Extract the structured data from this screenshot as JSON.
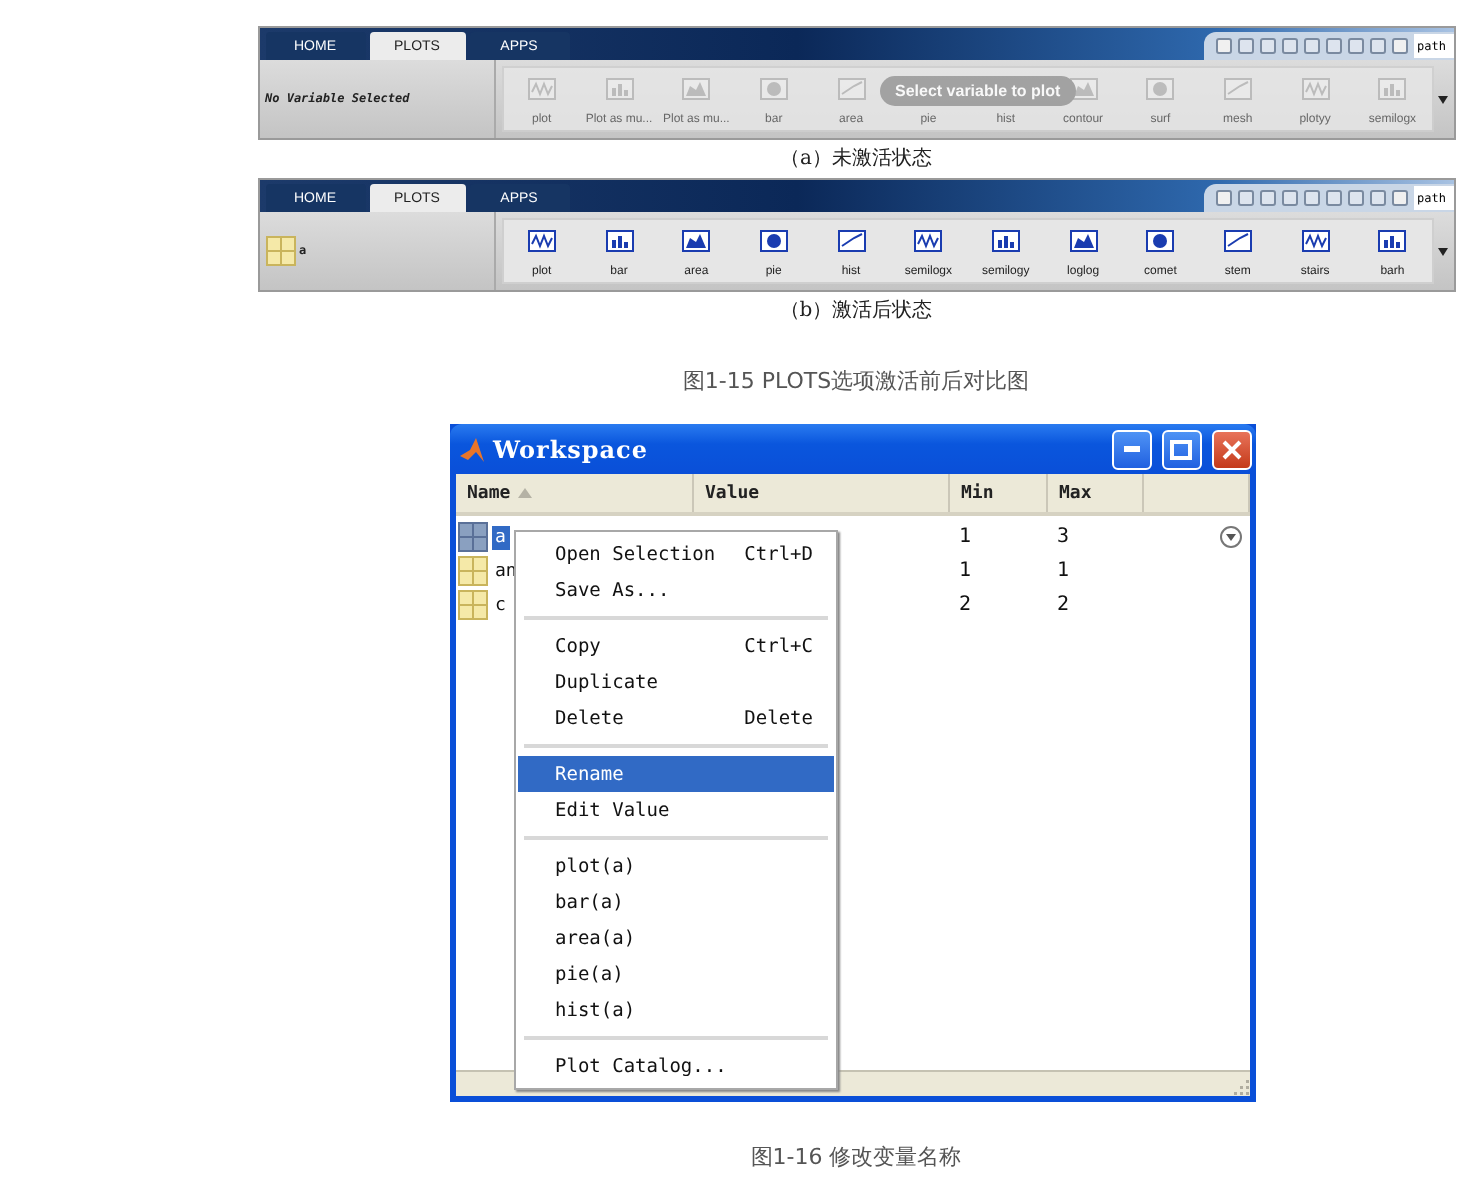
{
  "ribbons": [
    {
      "tabs": [
        {
          "label": "HOME",
          "selected": false
        },
        {
          "label": "PLOTS",
          "selected": true
        },
        {
          "label": "APPS",
          "selected": false
        }
      ],
      "search_value": "path",
      "variable_panel": {
        "kind": "empty",
        "text": "No Variable Selected"
      },
      "gallery_enabled": false,
      "gallery": [
        "plot",
        "Plot as mu...",
        "Plot as mu...",
        "bar",
        "area",
        "pie",
        "hist",
        "contour",
        "surf",
        "mesh",
        "plotyy",
        "semilogx"
      ],
      "tooltip": "Select variable to plot",
      "caption": "（a）未激活状态"
    },
    {
      "tabs": [
        {
          "label": "HOME",
          "selected": false
        },
        {
          "label": "PLOTS",
          "selected": true
        },
        {
          "label": "APPS",
          "selected": false
        }
      ],
      "search_value": "path",
      "variable_panel": {
        "kind": "variable",
        "text": "a"
      },
      "gallery_enabled": true,
      "gallery": [
        "plot",
        "bar",
        "area",
        "pie",
        "hist",
        "semilogx",
        "semilogy",
        "loglog",
        "comet",
        "stem",
        "stairs",
        "barh"
      ],
      "caption": "（b）激活后状态"
    }
  ],
  "ribbon_figure_caption": "图1-15 PLOTS选项激活前后对比图",
  "workspace": {
    "title": "Workspace",
    "columns": [
      "Name",
      "Value",
      "Min",
      "Max"
    ],
    "rows": [
      {
        "name": "a",
        "min": "1",
        "max": "3",
        "selected": true
      },
      {
        "name": "an",
        "min": "1",
        "max": "1",
        "selected": false
      },
      {
        "name": "c",
        "min": "2",
        "max": "2",
        "selected": false
      }
    ],
    "context_menu": [
      [
        {
          "label": "Open Selection",
          "shortcut": "Ctrl+D",
          "selected": false
        },
        {
          "label": "Save As...",
          "selected": false
        }
      ],
      [
        {
          "label": "Copy",
          "shortcut": "Ctrl+C",
          "selected": false
        },
        {
          "label": "Duplicate",
          "selected": false
        },
        {
          "label": "Delete",
          "shortcut": "Delete",
          "selected": false
        }
      ],
      [
        {
          "label": "Rename",
          "selected": true
        },
        {
          "label": "Edit Value",
          "selected": false
        }
      ],
      [
        {
          "label": "plot(a)",
          "selected": false
        },
        {
          "label": "bar(a)",
          "selected": false
        },
        {
          "label": "area(a)",
          "selected": false
        },
        {
          "label": "pie(a)",
          "selected": false
        },
        {
          "label": "hist(a)",
          "selected": false
        }
      ],
      [
        {
          "label": "Plot Catalog...",
          "selected": false
        }
      ]
    ]
  },
  "workspace_figure_caption": "图1-16 修改变量名称"
}
